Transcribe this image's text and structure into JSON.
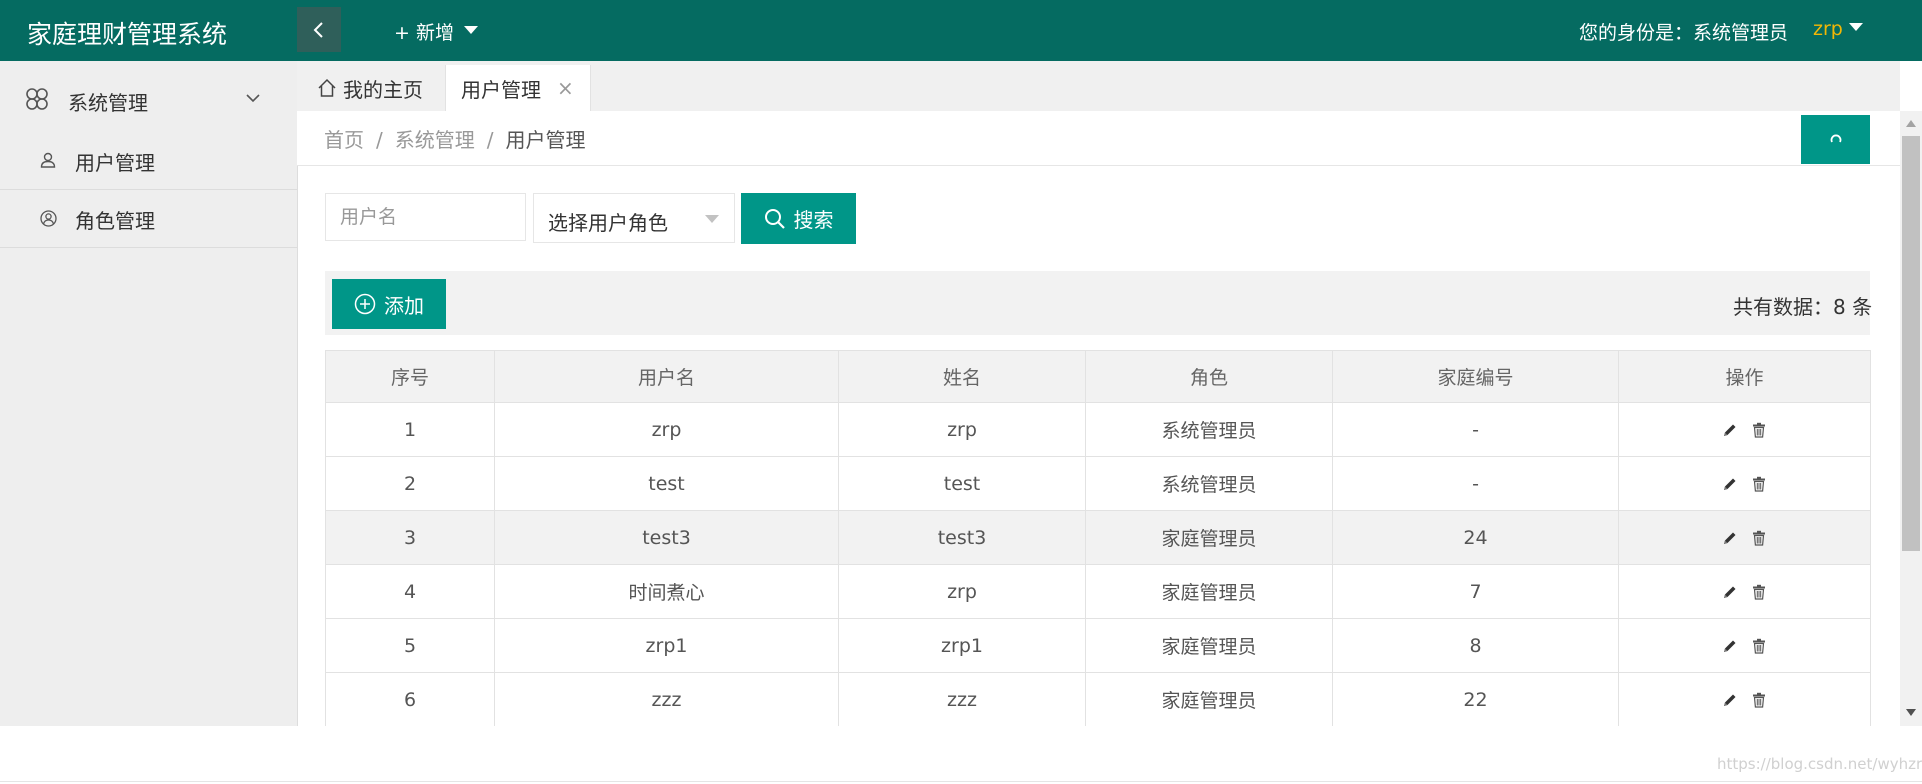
{
  "header": {
    "logo": "家庭理财管理系统",
    "add_label": "+ 新增",
    "identity": "您的身份是：系统管理员",
    "user": "zrp"
  },
  "sidebar": {
    "group_label": "系统管理",
    "items": [
      {
        "label": "用户管理",
        "icon": "user-icon"
      },
      {
        "label": "角色管理",
        "icon": "role-icon"
      }
    ]
  },
  "tabs": [
    {
      "label": "我的主页",
      "icon": "home-icon"
    },
    {
      "label": "用户管理",
      "close": "×"
    }
  ],
  "breadcrumb": {
    "items": [
      "首页",
      "系统管理",
      "用户管理"
    ],
    "separator": "/"
  },
  "search": {
    "username_placeholder": "用户名",
    "role_select_value": "选择用户角色",
    "search_label": "搜索"
  },
  "toolbar": {
    "add_label": "添加",
    "total_text": "共有数据：8 条"
  },
  "table": {
    "headers": [
      "序号",
      "用户名",
      "姓名",
      "角色",
      "家庭编号",
      "操作"
    ],
    "rows": [
      [
        "1",
        "zrp",
        "zrp",
        "系统管理员",
        "-"
      ],
      [
        "2",
        "test",
        "test",
        "系统管理员",
        "-"
      ],
      [
        "3",
        "test3",
        "test3",
        "家庭管理员",
        "24"
      ],
      [
        "4",
        "时间煮心",
        "zrp",
        "家庭管理员",
        "7"
      ],
      [
        "5",
        "zrp1",
        "zrp1",
        "家庭管理员",
        "8"
      ],
      [
        "6",
        "zzz",
        "zzz",
        "家庭管理员",
        "22"
      ]
    ]
  },
  "watermark": "https://blog.csdn.net/wyhzrp",
  "colors": {
    "header_bg": "#056b61",
    "accent": "#009688",
    "user_name": "#f2b705"
  }
}
